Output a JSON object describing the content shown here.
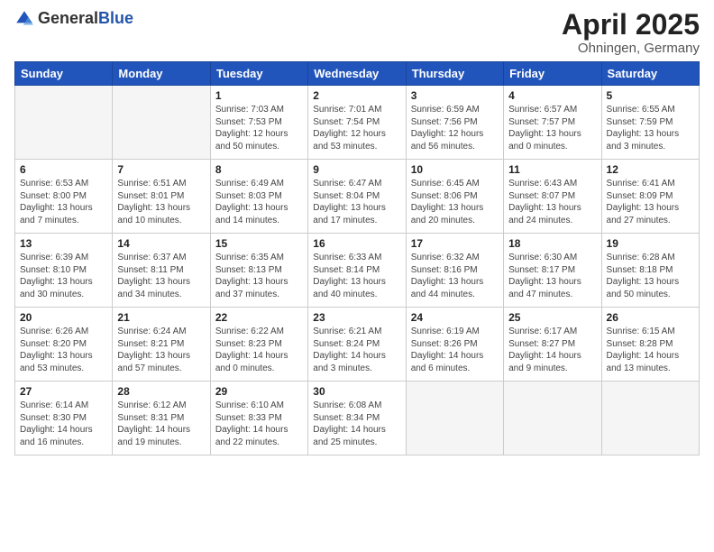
{
  "logo": {
    "general": "General",
    "blue": "Blue"
  },
  "title": "April 2025",
  "location": "Ohningen, Germany",
  "weekdays": [
    "Sunday",
    "Monday",
    "Tuesday",
    "Wednesday",
    "Thursday",
    "Friday",
    "Saturday"
  ],
  "weeks": [
    [
      {
        "day": "",
        "info": ""
      },
      {
        "day": "",
        "info": ""
      },
      {
        "day": "1",
        "info": "Sunrise: 7:03 AM\nSunset: 7:53 PM\nDaylight: 12 hours and 50 minutes."
      },
      {
        "day": "2",
        "info": "Sunrise: 7:01 AM\nSunset: 7:54 PM\nDaylight: 12 hours and 53 minutes."
      },
      {
        "day": "3",
        "info": "Sunrise: 6:59 AM\nSunset: 7:56 PM\nDaylight: 12 hours and 56 minutes."
      },
      {
        "day": "4",
        "info": "Sunrise: 6:57 AM\nSunset: 7:57 PM\nDaylight: 13 hours and 0 minutes."
      },
      {
        "day": "5",
        "info": "Sunrise: 6:55 AM\nSunset: 7:59 PM\nDaylight: 13 hours and 3 minutes."
      }
    ],
    [
      {
        "day": "6",
        "info": "Sunrise: 6:53 AM\nSunset: 8:00 PM\nDaylight: 13 hours and 7 minutes."
      },
      {
        "day": "7",
        "info": "Sunrise: 6:51 AM\nSunset: 8:01 PM\nDaylight: 13 hours and 10 minutes."
      },
      {
        "day": "8",
        "info": "Sunrise: 6:49 AM\nSunset: 8:03 PM\nDaylight: 13 hours and 14 minutes."
      },
      {
        "day": "9",
        "info": "Sunrise: 6:47 AM\nSunset: 8:04 PM\nDaylight: 13 hours and 17 minutes."
      },
      {
        "day": "10",
        "info": "Sunrise: 6:45 AM\nSunset: 8:06 PM\nDaylight: 13 hours and 20 minutes."
      },
      {
        "day": "11",
        "info": "Sunrise: 6:43 AM\nSunset: 8:07 PM\nDaylight: 13 hours and 24 minutes."
      },
      {
        "day": "12",
        "info": "Sunrise: 6:41 AM\nSunset: 8:09 PM\nDaylight: 13 hours and 27 minutes."
      }
    ],
    [
      {
        "day": "13",
        "info": "Sunrise: 6:39 AM\nSunset: 8:10 PM\nDaylight: 13 hours and 30 minutes."
      },
      {
        "day": "14",
        "info": "Sunrise: 6:37 AM\nSunset: 8:11 PM\nDaylight: 13 hours and 34 minutes."
      },
      {
        "day": "15",
        "info": "Sunrise: 6:35 AM\nSunset: 8:13 PM\nDaylight: 13 hours and 37 minutes."
      },
      {
        "day": "16",
        "info": "Sunrise: 6:33 AM\nSunset: 8:14 PM\nDaylight: 13 hours and 40 minutes."
      },
      {
        "day": "17",
        "info": "Sunrise: 6:32 AM\nSunset: 8:16 PM\nDaylight: 13 hours and 44 minutes."
      },
      {
        "day": "18",
        "info": "Sunrise: 6:30 AM\nSunset: 8:17 PM\nDaylight: 13 hours and 47 minutes."
      },
      {
        "day": "19",
        "info": "Sunrise: 6:28 AM\nSunset: 8:18 PM\nDaylight: 13 hours and 50 minutes."
      }
    ],
    [
      {
        "day": "20",
        "info": "Sunrise: 6:26 AM\nSunset: 8:20 PM\nDaylight: 13 hours and 53 minutes."
      },
      {
        "day": "21",
        "info": "Sunrise: 6:24 AM\nSunset: 8:21 PM\nDaylight: 13 hours and 57 minutes."
      },
      {
        "day": "22",
        "info": "Sunrise: 6:22 AM\nSunset: 8:23 PM\nDaylight: 14 hours and 0 minutes."
      },
      {
        "day": "23",
        "info": "Sunrise: 6:21 AM\nSunset: 8:24 PM\nDaylight: 14 hours and 3 minutes."
      },
      {
        "day": "24",
        "info": "Sunrise: 6:19 AM\nSunset: 8:26 PM\nDaylight: 14 hours and 6 minutes."
      },
      {
        "day": "25",
        "info": "Sunrise: 6:17 AM\nSunset: 8:27 PM\nDaylight: 14 hours and 9 minutes."
      },
      {
        "day": "26",
        "info": "Sunrise: 6:15 AM\nSunset: 8:28 PM\nDaylight: 14 hours and 13 minutes."
      }
    ],
    [
      {
        "day": "27",
        "info": "Sunrise: 6:14 AM\nSunset: 8:30 PM\nDaylight: 14 hours and 16 minutes."
      },
      {
        "day": "28",
        "info": "Sunrise: 6:12 AM\nSunset: 8:31 PM\nDaylight: 14 hours and 19 minutes."
      },
      {
        "day": "29",
        "info": "Sunrise: 6:10 AM\nSunset: 8:33 PM\nDaylight: 14 hours and 22 minutes."
      },
      {
        "day": "30",
        "info": "Sunrise: 6:08 AM\nSunset: 8:34 PM\nDaylight: 14 hours and 25 minutes."
      },
      {
        "day": "",
        "info": ""
      },
      {
        "day": "",
        "info": ""
      },
      {
        "day": "",
        "info": ""
      }
    ]
  ]
}
